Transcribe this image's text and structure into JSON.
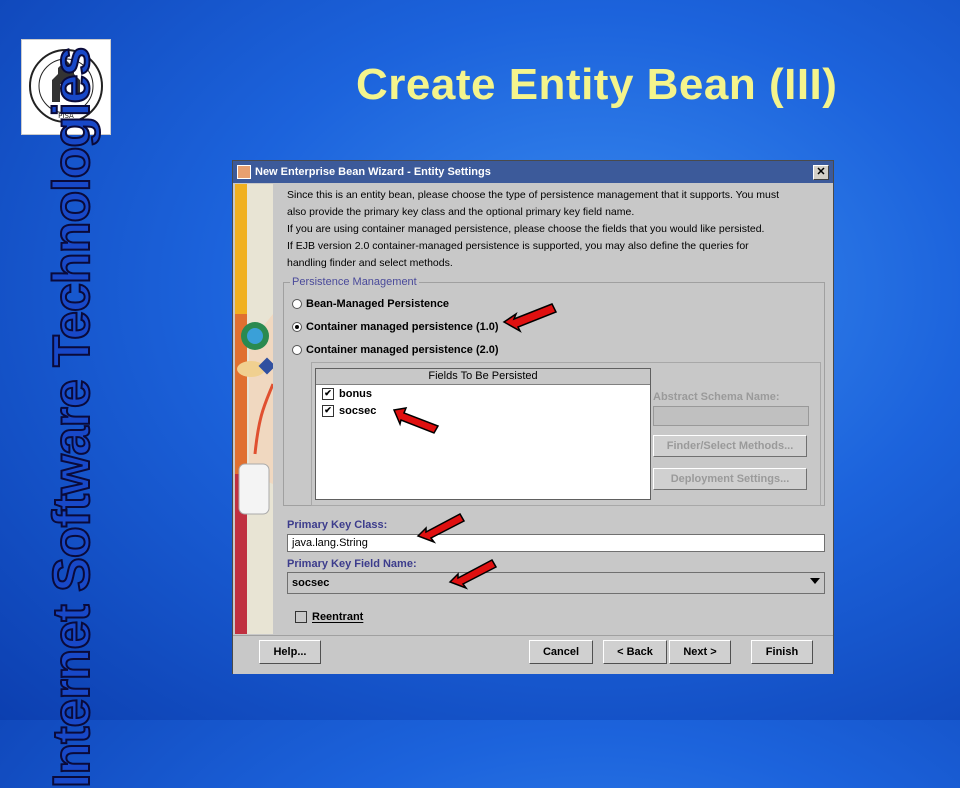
{
  "slide": {
    "title": "Create Entity Bean (III)",
    "side_text": "Internet Software Technologies"
  },
  "dialog": {
    "title": "New Enterprise Bean Wizard - Entity Settings",
    "intro": [
      "Since this is an entity bean, please choose the type of persistence management that it supports.  You must",
      "also provide the primary key class and the optional primary key field name.",
      "If you are using container managed persistence, please choose the fields that you would like persisted.",
      "If EJB version 2.0 container-managed persistence is supported, you may also define the queries for",
      "handling finder and select methods."
    ],
    "persistence_legend": "Persistence Management",
    "radios": [
      {
        "label": "Bean-Managed Persistence",
        "selected": false
      },
      {
        "label": "Container managed persistence (1.0)",
        "selected": true
      },
      {
        "label": "Container managed persistence (2.0)",
        "selected": false
      }
    ],
    "fields_header": "Fields To Be Persisted",
    "fields": [
      {
        "name": "bonus",
        "checked": true
      },
      {
        "name": "socsec",
        "checked": true
      }
    ],
    "abstract_schema_label": "Abstract Schema Name:",
    "finder_button": "Finder/Select Methods...",
    "deployment_button": "Deployment Settings...",
    "primary_key_class_label": "Primary Key Class:",
    "primary_key_class_value": "java.lang.String",
    "primary_key_field_label": "Primary Key Field Name:",
    "primary_key_field_value": "socsec",
    "reentrant_label": "Reentrant",
    "reentrant_checked": false,
    "buttons": {
      "help": "Help...",
      "cancel": "Cancel",
      "back": "< Back",
      "next": "Next >",
      "finish": "Finish"
    }
  },
  "colors": {
    "title_yellow": "#f4f48c",
    "arrow_red": "#e01010",
    "titlebar": "#3c5a9a"
  }
}
